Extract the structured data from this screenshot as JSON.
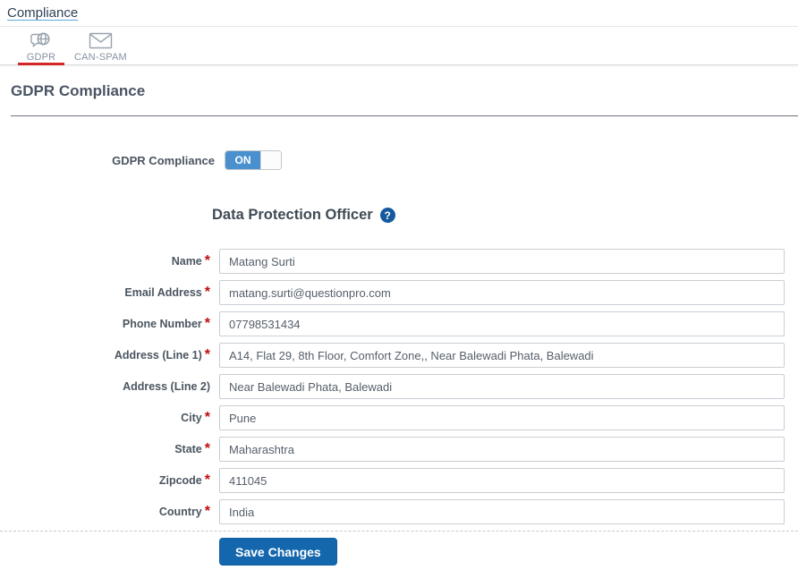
{
  "header": {
    "breadcrumb": "Compliance"
  },
  "tabs": [
    {
      "label": "GDPR",
      "icon": "gdpr-globe-icon",
      "active": true
    },
    {
      "label": "CAN-SPAM",
      "icon": "envelope-icon",
      "active": false
    }
  ],
  "page": {
    "title": "GDPR Compliance",
    "toggle": {
      "label": "GDPR Compliance",
      "state": "ON",
      "enabled": true
    },
    "section": {
      "title": "Data Protection Officer",
      "help_icon": "question-circle-icon",
      "help_glyph": "?"
    }
  },
  "form": {
    "required_marker": "*",
    "fields": [
      {
        "label": "Name",
        "required": true,
        "value": "Matang Surti"
      },
      {
        "label": "Email Address",
        "required": true,
        "value": "matang.surti@questionpro.com"
      },
      {
        "label": "Phone Number",
        "required": true,
        "value": "07798531434"
      },
      {
        "label": "Address (Line 1)",
        "required": true,
        "value": "A14, Flat 29, 8th Floor, Comfort Zone,, Near Balewadi Phata, Balewadi"
      },
      {
        "label": "Address (Line 2)",
        "required": false,
        "value": "Near Balewadi Phata, Balewadi"
      },
      {
        "label": "City",
        "required": true,
        "value": "Pune"
      },
      {
        "label": "State",
        "required": true,
        "value": "Maharashtra"
      },
      {
        "label": "Zipcode",
        "required": true,
        "value": "411045"
      },
      {
        "label": "Country",
        "required": true,
        "value": "India"
      }
    ],
    "save_button": "Save Changes"
  },
  "colors": {
    "accent_blue": "#1467ad",
    "toggle_blue": "#4a90cf",
    "active_tab_red": "#d32727",
    "link_underline_blue": "#58aadb",
    "help_icon_blue": "#15599e",
    "required_red": "#c00d0d"
  }
}
